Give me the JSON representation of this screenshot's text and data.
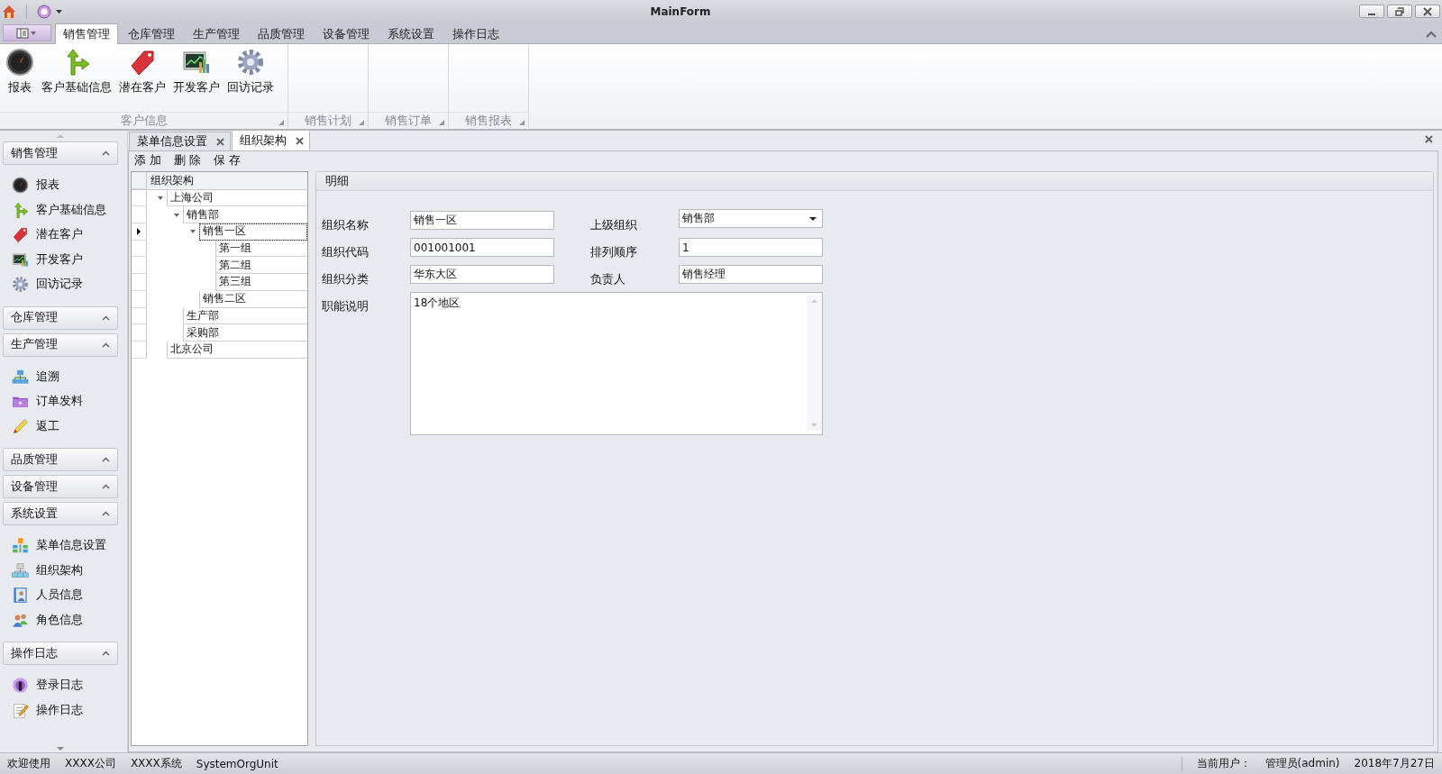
{
  "window": {
    "title": "MainForm"
  },
  "ribbon": {
    "tabs": [
      {
        "label": "销售管理",
        "selected": true
      },
      {
        "label": "仓库管理",
        "selected": false
      },
      {
        "label": "生产管理",
        "selected": false
      },
      {
        "label": "品质管理",
        "selected": false
      },
      {
        "label": "设备管理",
        "selected": false
      },
      {
        "label": "系统设置",
        "selected": false
      },
      {
        "label": "操作日志",
        "selected": false
      }
    ],
    "groups": [
      {
        "label": "客户信息",
        "buttons": [
          "报表",
          "客户基础信息",
          "潜在客户",
          "开发客户",
          "回访记录"
        ]
      },
      {
        "label": "销售计划"
      },
      {
        "label": "销售订单"
      },
      {
        "label": "销售报表"
      }
    ]
  },
  "sidebar": {
    "groups": [
      {
        "label": "销售管理",
        "items": [
          "报表",
          "客户基础信息",
          "潜在客户",
          "开发客户",
          "回访记录"
        ]
      },
      {
        "label": "仓库管理"
      },
      {
        "label": "生产管理",
        "items": [
          "追溯",
          "订单发料",
          "返工"
        ]
      },
      {
        "label": "品质管理"
      },
      {
        "label": "设备管理"
      },
      {
        "label": "系统设置",
        "items": [
          "菜单信息设置",
          "组织架构",
          "人员信息",
          "角色信息"
        ]
      },
      {
        "label": "操作日志",
        "items": [
          "登录日志",
          "操作日志"
        ]
      }
    ]
  },
  "document_tabs": [
    {
      "label": "菜单信息设置",
      "selected": false
    },
    {
      "label": "组织架构",
      "selected": true
    }
  ],
  "toolbar": [
    "添 加",
    "删 除",
    "保 存"
  ],
  "tree": {
    "header": "组织架构",
    "nodes": [
      {
        "label": "上海公司",
        "expanded": true,
        "selected": false,
        "children": [
          {
            "label": "销售部",
            "expanded": true,
            "selected": false,
            "children": [
              {
                "label": "销售一区",
                "expanded": true,
                "selected": true,
                "children": [
                  {
                    "label": "第一组",
                    "selected": false
                  },
                  {
                    "label": "第二组",
                    "selected": false
                  },
                  {
                    "label": "第三组",
                    "selected": false
                  }
                ]
              },
              {
                "label": "销售二区",
                "selected": false
              }
            ]
          },
          {
            "label": "生产部",
            "selected": false
          },
          {
            "label": "采购部",
            "selected": false
          }
        ]
      },
      {
        "label": "北京公司",
        "selected": false
      }
    ]
  },
  "details": {
    "title": "明细",
    "fields": [
      {
        "label": "组织名称",
        "value": "销售一区",
        "kind": "text"
      },
      {
        "label": "上级组织",
        "value": "销售部",
        "kind": "combo"
      },
      {
        "label": "组织代码",
        "value": "001001001",
        "kind": "text"
      },
      {
        "label": "排列顺序",
        "value": "1",
        "kind": "text"
      },
      {
        "label": "组织分类",
        "value": "华东大区",
        "kind": "text"
      },
      {
        "label": "负责人",
        "value": "销售经理",
        "kind": "text"
      },
      {
        "label": "职能说明",
        "value": "18个地区",
        "kind": "memo"
      }
    ]
  },
  "status_bar": {
    "left": [
      "欢迎使用",
      "XXXX公司",
      "XXXX系统",
      "SystemOrgUnit"
    ],
    "right": [
      "当前用户：",
      "管理员(admin)",
      "2018年7月27日"
    ]
  }
}
